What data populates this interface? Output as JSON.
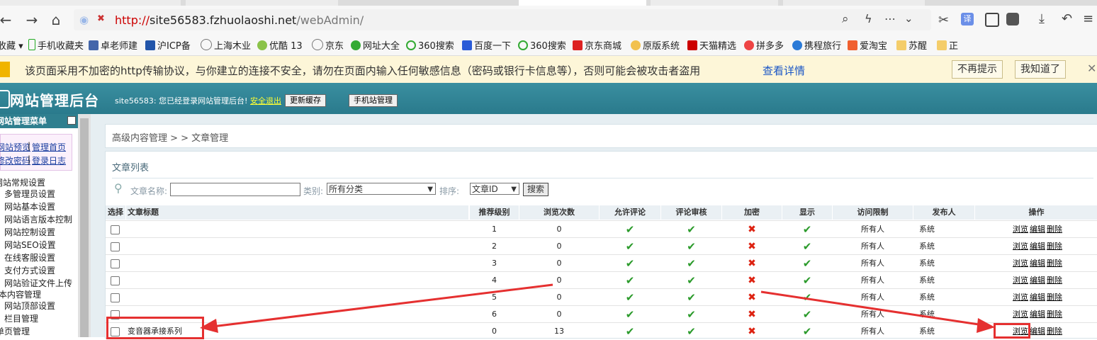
{
  "browser": {
    "url_protocol": "http://",
    "url_host": "site56583.fzhuolaoshi.net",
    "url_path": "/webAdmin/",
    "bookmarks": [
      "收藏",
      "手机收藏夹",
      "卓老师建",
      "沪ICP备",
      "上海木业",
      "优酷 13",
      "京东",
      "网址大全",
      "360搜索",
      "百度一下",
      "360搜索",
      "京东商城",
      "原版系统",
      "天猫精选",
      "拼多多",
      "携程旅行",
      "爱淘宝",
      "苏醒",
      "正"
    ],
    "warning_text": "该页面采用不加密的http传输协议，与你建立的连接不安全，请勿在页面内输入任何敏感信息（密码或银行卡信息等），否则可能会被攻击者盗用",
    "warning_link": "查看详情",
    "warning_btn_never": "不再提示",
    "warning_btn_ok": "我知道了"
  },
  "header": {
    "logo": "网站管理后台",
    "info": "site56583: 您已经登录网站管理后台!",
    "logout": "安全退出",
    "btn_cache": "更新缓存",
    "btn_mobile": "手机站管理"
  },
  "sidebar": {
    "title": "网站管理菜单",
    "links": [
      "网站预览",
      "管理首页",
      "修改密码",
      "登录日志"
    ],
    "sections": [
      {
        "title": "网站常规设置",
        "items": [
          "多管理员设置",
          "网站基本设置",
          "网站语言版本控制",
          "网站控制设置",
          "网站SEO设置",
          "在线客服设置",
          "支付方式设置",
          "网站验证文件上传"
        ]
      },
      {
        "title": "基本内容管理",
        "items": [
          "网站顶部设置",
          "栏目管理",
          "单页管理"
        ]
      }
    ]
  },
  "main": {
    "breadcrumb": "高级内容管理 > > 文章管理",
    "panel_title": "文章列表",
    "search": {
      "name_label": "文章名称:",
      "category_label": "类别:",
      "category_value": "所有分类",
      "sort_label": "排序:",
      "sort_value": "文章ID",
      "button": "搜索"
    },
    "columns": [
      "选择",
      "文章标题",
      "推荐级别",
      "浏览次数",
      "允许评论",
      "评论审核",
      "加密",
      "显示",
      "访问限制",
      "发布人",
      "操作"
    ],
    "rows": [
      {
        "title": "",
        "level": "1",
        "views": "0",
        "comment": "✔",
        "review": "✔",
        "encrypt": "✖",
        "show": "✔",
        "access": "所有人",
        "author": "系统"
      },
      {
        "title": "",
        "level": "2",
        "views": "0",
        "comment": "✔",
        "review": "✔",
        "encrypt": "✖",
        "show": "✔",
        "access": "所有人",
        "author": "系统"
      },
      {
        "title": "",
        "level": "3",
        "views": "0",
        "comment": "✔",
        "review": "✔",
        "encrypt": "✖",
        "show": "✔",
        "access": "所有人",
        "author": "系统"
      },
      {
        "title": "",
        "level": "4",
        "views": "0",
        "comment": "✔",
        "review": "✔",
        "encrypt": "✖",
        "show": "✔",
        "access": "所有人",
        "author": "系统"
      },
      {
        "title": "",
        "level": "5",
        "views": "0",
        "comment": "✔",
        "review": "✔",
        "encrypt": "✖",
        "show": "✔",
        "access": "所有人",
        "author": "系统"
      },
      {
        "title": "",
        "level": "6",
        "views": "0",
        "comment": "✔",
        "review": "✔",
        "encrypt": "✖",
        "show": "✔",
        "access": "所有人",
        "author": "系统"
      },
      {
        "title": "变音器承接系列",
        "level": "0",
        "views": "13",
        "comment": "✔",
        "review": "✔",
        "encrypt": "✖",
        "show": "✔",
        "access": "所有人",
        "author": "系统"
      }
    ],
    "actions": [
      "浏览",
      "编辑",
      "删除"
    ]
  },
  "annotation_color": "#e53030"
}
